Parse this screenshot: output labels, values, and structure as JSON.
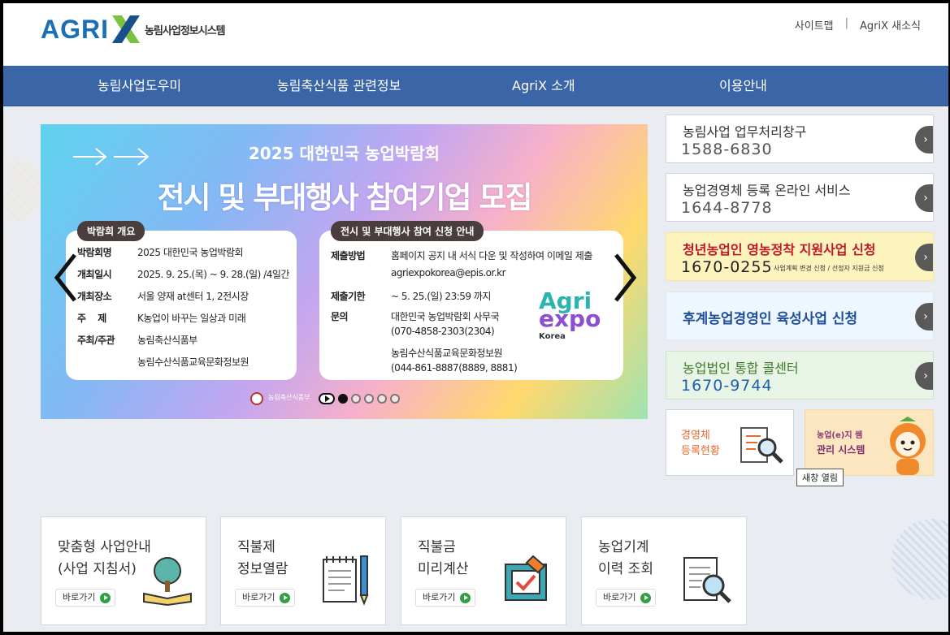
{
  "header": {
    "logo_text": "AGRI",
    "logo_sub": "농림사업정보시스템",
    "util_links": [
      "사이트맵",
      "AgriX 새소식"
    ],
    "util_sep": "|"
  },
  "nav": [
    "농림사업도우미",
    "농림축산식품 관련정보",
    "AgriX 소개",
    "이용안내"
  ],
  "banner": {
    "subtitle": "2025 대한민국 농업박람회",
    "title": "전시 및 부대행사 참여기업 모집",
    "overview": {
      "pill": "박람회 개요",
      "rows": [
        {
          "k": "박람회명",
          "v": "2025 대한민국 농업박람회"
        },
        {
          "k": "개최일시",
          "v": "2025. 9. 25.(목) ~ 9. 28.(일) /4일간"
        },
        {
          "k": "개최장소",
          "v": "서울 양재 at센터 1, 2전시장"
        },
        {
          "k": "주    제",
          "v": "K농업이 바꾸는 일상과 미래"
        },
        {
          "k": "주최/주관",
          "v": "농림축산식품부"
        },
        {
          "k": "",
          "v": "농림수산식품교육문화정보원"
        }
      ]
    },
    "apply": {
      "pill": "전시 및 부대행사 참여 신청 안내",
      "rows": [
        {
          "k": "제출방법",
          "v": "홈페이지 공지 내 서식 다운 및 작성하여 이메일 제출"
        },
        {
          "k": "",
          "v": "agriexpokorea@epis.or.kr"
        },
        {
          "k": "제출기한",
          "v": "~ 5. 25.(일) 23:59 까지"
        },
        {
          "k": "문의",
          "v": "대한민국 농업박람회 사무국"
        },
        {
          "k": "",
          "v": "(070-4858-2303(2304)"
        },
        {
          "k": "",
          "v": "농림수산식품교육문화정보원"
        },
        {
          "k": "",
          "v": "(044-861-8887(8889, 8881)"
        }
      ],
      "expo_logo": [
        "Agri",
        "expo",
        "Korea"
      ]
    },
    "footer_orgs": "농림축산식품부"
  },
  "services": [
    {
      "title": "농림사업 업무처리창구",
      "phone": "1588-6830",
      "style": "white"
    },
    {
      "title": "농업경영체 등록 온라인 서비스",
      "phone": "1644-8778",
      "style": "white"
    },
    {
      "title": "청년농업인 영농정착 지원사업 신청",
      "phone": "1670-0255",
      "note": "사업계획 변경 신청 / 선정자 지원금 신청",
      "style": "yellow"
    },
    {
      "title": "후계농업경영인 육성사업 신청",
      "style": "blue"
    },
    {
      "title": "농업법인 통합 콜센터",
      "phone": "1670-9744",
      "style": "green"
    }
  ],
  "tiles": {
    "registry": "경영체\n등록현황",
    "system_line1": "농업(e)지 쌤",
    "system_line2": "관리 시스템",
    "tooltip": "새창 열림"
  },
  "boxes": [
    {
      "title": "맞춤형 사업안내\n(사업 지침서)",
      "btn": "바로가기"
    },
    {
      "title": "직불제\n정보열람",
      "btn": "바로가기"
    },
    {
      "title": "직불금\n미리계산",
      "btn": "바로가기"
    },
    {
      "title": "농업기계\n이력 조회",
      "btn": "바로가기"
    }
  ],
  "colors": {
    "nav": "#3a66a8",
    "brand_blue": "#1a6fb5",
    "brand_green": "#7cc242",
    "go_button": "#595959"
  }
}
